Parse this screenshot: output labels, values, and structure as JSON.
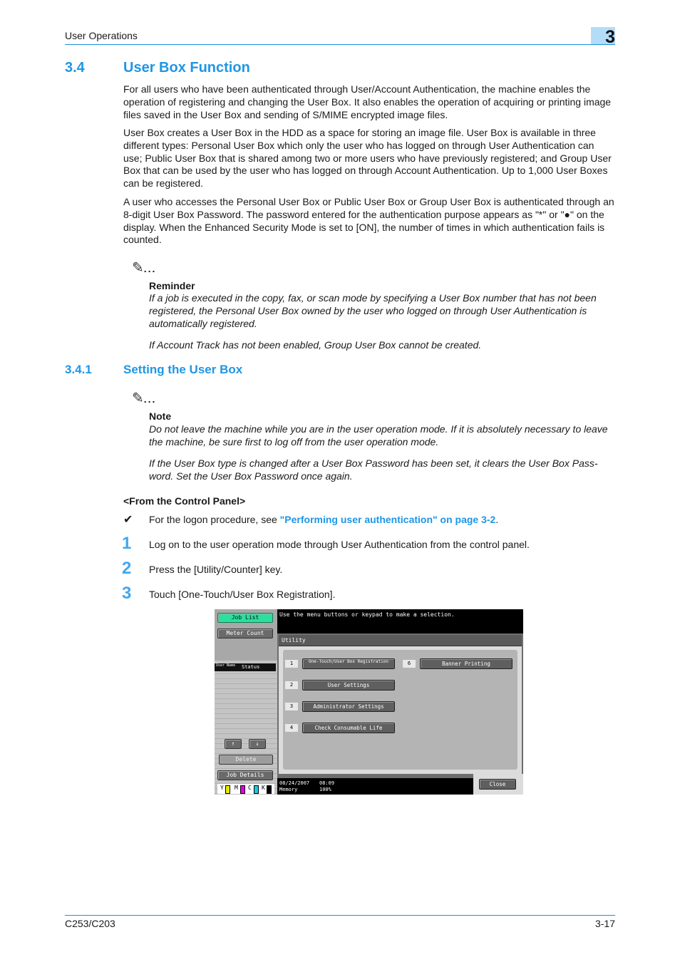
{
  "header": {
    "section": "User Operations",
    "chapter": "3"
  },
  "section": {
    "number": "3.4",
    "title": "User Box Function",
    "paragraphs": [
      "For all users who have been authenticated through User/Account Authentication, the machine enables the operation of registering and changing the User Box. It also enables the operation of acquiring or printing image files saved in the User Box and sending of S/MIME encrypted image files.",
      "User Box creates a User Box in the HDD as a space for storing an image file. User Box is available in three different types: Personal User Box which only the user who has logged on through User Authentication can use; Public User Box that is shared among two or more users who have previously registered; and Group User Box that can be used by the user who has logged on through Account Authentication. Up to 1,000 User Boxes can be registered.",
      "A user who accesses the Personal User Box or Public User Box or Group User Box is authenticated through an 8-digit User Box Password. The password entered for the authentication purpose appears as \"*\" or \"●\" on the display. When the Enhanced Security Mode is set to [ON], the number of times in which authentication fails is counted."
    ],
    "reminder": {
      "icon": "pencil-icon",
      "label": "Reminder",
      "items": [
        "If a job is executed in the copy, fax, or scan mode by specifying a User Box number that has not been registered, the Personal User Box owned by the user who logged on through User Authentication is automatically registered.",
        "If Account Track has not been enabled, Group User Box cannot be created."
      ]
    }
  },
  "subsection": {
    "number": "3.4.1",
    "title": "Setting the User Box",
    "note": {
      "icon": "pencil-icon",
      "label": "Note",
      "items": [
        "Do not leave the machine while you are in the user operation mode. If it is absolutely necessary to leave the machine, be sure first to log off from the user operation mode.",
        "If the User Box type is changed after a User Box Password has been set, it clears the User Box Pass-word. Set the User Box Password once again."
      ]
    },
    "procedure_title": "<From the Control Panel>",
    "prereq": {
      "prefix": "For the logon procedure, see ",
      "link": "\"Performing user authentication\" on page 3-2",
      "suffix": "."
    },
    "steps": [
      {
        "num": "1",
        "text": "Log on to the user operation mode through User Authentication from the control panel."
      },
      {
        "num": "2",
        "text": "Press the [Utility/Counter] key."
      },
      {
        "num": "3",
        "text": "Touch [One-Touch/User Box Registration]."
      }
    ]
  },
  "panel": {
    "job_list": "Job List",
    "meter_count": "Meter Count",
    "status_user": "User Name",
    "status_label": "Status",
    "delete": "Delete",
    "job_details": "Job Details",
    "toner": [
      "Y",
      "M",
      "C",
      "K"
    ],
    "toner_colors": [
      "#e8e800",
      "#e000e0",
      "#20c8e0",
      "#000000"
    ],
    "message": "Use the menu buttons or keypad to make a selection.",
    "utility_title": "Utility",
    "menu": [
      {
        "num": "1",
        "label": "One-Touch/User Box Registration"
      },
      {
        "num": "2",
        "label": "User Settings"
      },
      {
        "num": "3",
        "label": "Administrator Settings"
      },
      {
        "num": "4",
        "label": "Check Consumable Life"
      },
      {
        "num": "6",
        "label": "Banner Printing"
      }
    ],
    "date": "08/24/2007",
    "time": "08:09",
    "memory_label": "Memory",
    "memory_value": "100%",
    "close": "Close"
  },
  "footer": {
    "model": "C253/C203",
    "page": "3-17"
  }
}
